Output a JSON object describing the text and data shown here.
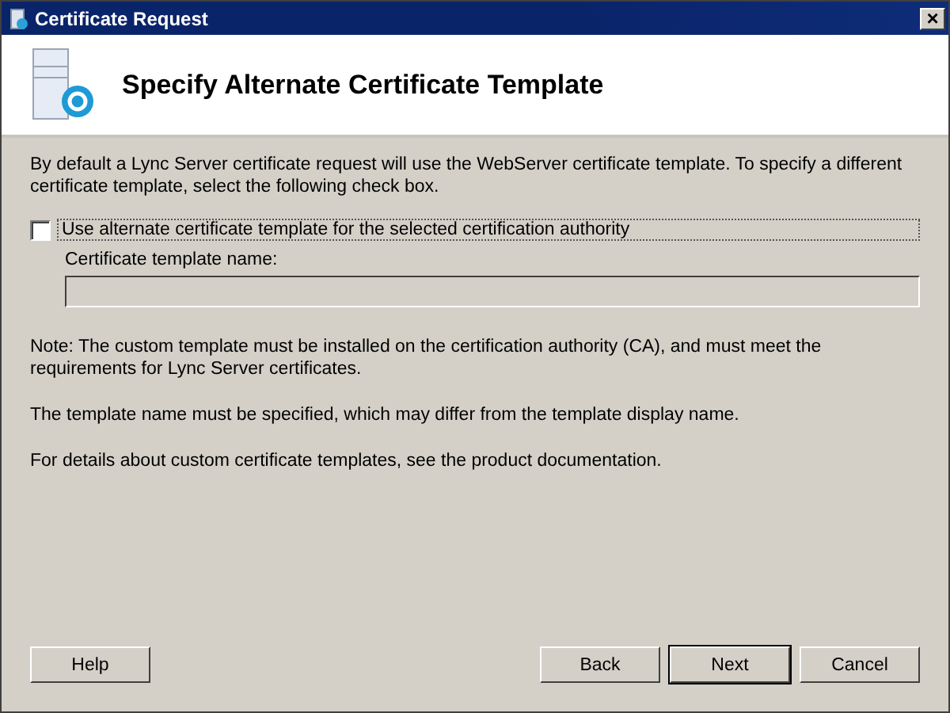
{
  "window": {
    "title": "Certificate Request",
    "close": "×"
  },
  "header": {
    "title": "Specify Alternate Certificate Template"
  },
  "intro": "By default a Lync Server certificate request will use the WebServer certificate template. To specify a different certificate template, select the following check box.",
  "checkbox": {
    "label": "Use alternate certificate template for the selected certification authority",
    "checked": false,
    "focused": true
  },
  "template_field": {
    "label": "Certificate template name:",
    "disabled": true
  },
  "notes": [
    "Note: The custom template must be installed on the certification authority (CA), and must meet the requirements for Lync Server certificates.",
    "The template name must be specified, which may differ from the template display name.",
    "For details about custom certificate templates, see the product documentation."
  ],
  "buttons": [
    {
      "label": "Help",
      "default": false
    },
    {
      "label": "Back",
      "default": false
    },
    {
      "label": "Next",
      "default": true
    },
    {
      "label": "Cancel",
      "default": false
    }
  ]
}
